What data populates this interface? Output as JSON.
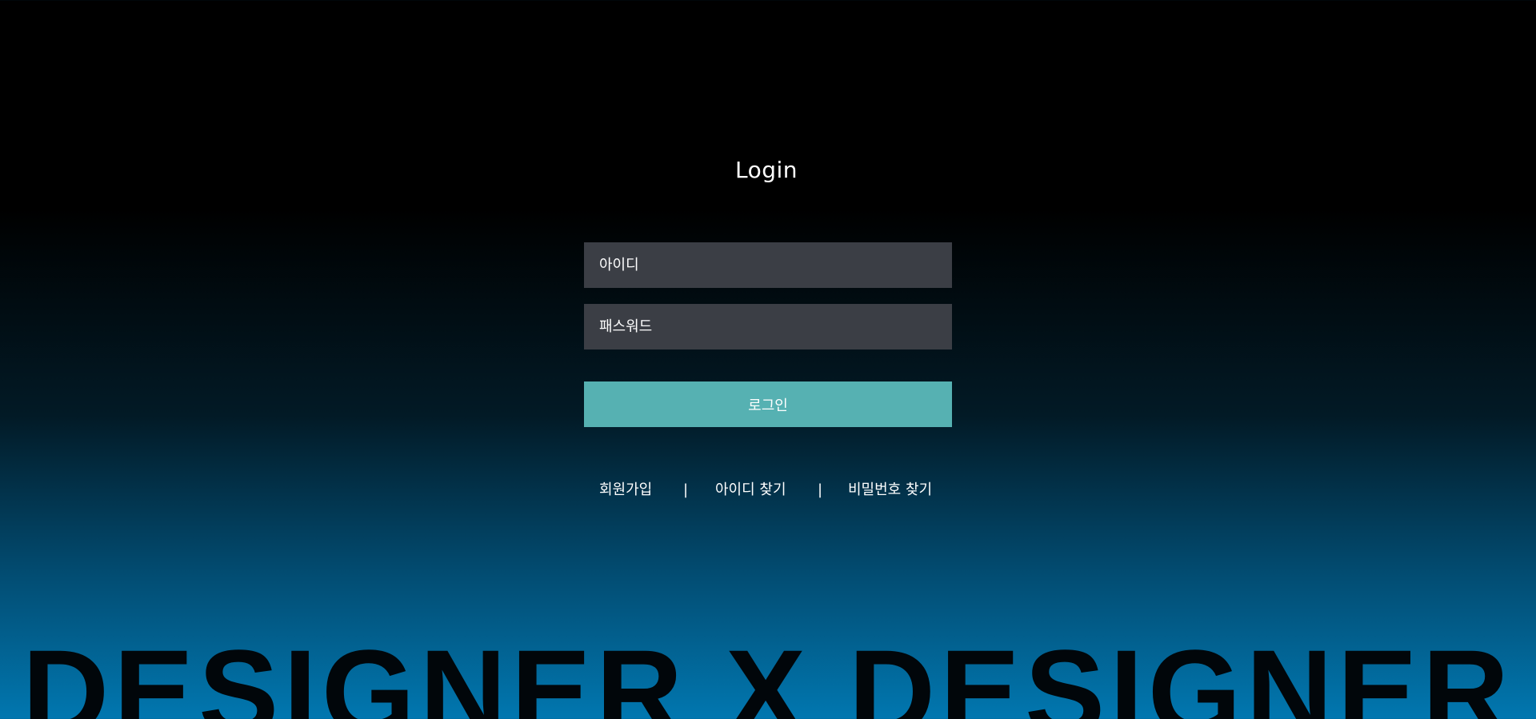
{
  "login": {
    "title": "Login",
    "id_placeholder": "아이디",
    "password_placeholder": "패스워드",
    "submit_label": "로그인"
  },
  "links": {
    "signup": "회원가입",
    "separator": "|",
    "find_id": "아이디 찾기",
    "find_password": "비밀번호 찾기"
  },
  "brand": {
    "text": "DESIGNER X DESIGNER"
  },
  "colors": {
    "input_background": "#3b3e45",
    "button_background": "#56b1b2",
    "gradient_top": "#000000",
    "gradient_bottom": "#0177b0"
  }
}
